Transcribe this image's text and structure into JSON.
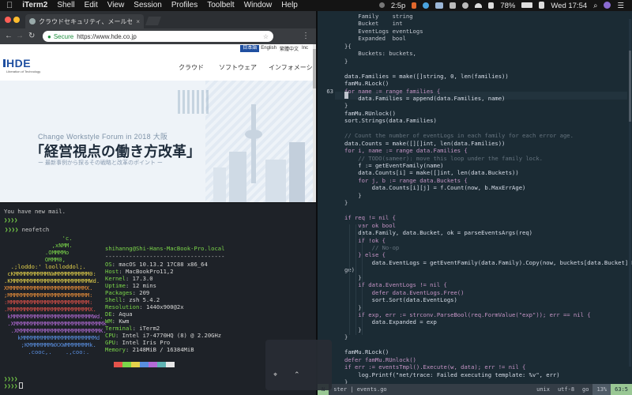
{
  "menubar": {
    "apple": "",
    "app": "iTerm2",
    "items": [
      "Shell",
      "Edit",
      "View",
      "Session",
      "Profiles",
      "Toolbelt",
      "Window",
      "Help"
    ],
    "status_time_left": "2:5p",
    "battery": "78%",
    "clock": "Wed 17:54"
  },
  "chrome": {
    "tab_title": "クラウドセキュリティ、メールセ",
    "tab_close": "×",
    "url_secure": "Secure",
    "url": "https://www.hde.co.jp",
    "star": "☆",
    "menu_dots": "⋮",
    "back": "←",
    "forward": "→",
    "reload": "↻"
  },
  "site": {
    "languages": [
      "日本語",
      "English",
      "繁體中文",
      "Inc"
    ],
    "logo": "HDE",
    "logo_sub": "Liberation of Technology",
    "nav": [
      "クラウド",
      "ソフトウェア",
      "インフォメーシ"
    ],
    "forum": "Change Workstyle Forum in 2018 大阪",
    "headline": "「経営視点の働き方改革」",
    "subline": "ー 最新事例から探るその戦略と改革のポイント ー"
  },
  "terminal": {
    "mail": "You have new mail.",
    "prompt": "❯❯❯❯",
    "command": "neofetch",
    "user_host": "shihanng@Shi-Hans-MacBook-Pro.local",
    "separator": "-----------------------------------",
    "info": [
      {
        "key": "OS",
        "val": "macOS 10.13.2 17C88 x86_64"
      },
      {
        "key": "Host",
        "val": "MacBookPro11,2"
      },
      {
        "key": "Kernel",
        "val": "17.3.0"
      },
      {
        "key": "Uptime",
        "val": "12 mins"
      },
      {
        "key": "Packages",
        "val": "209"
      },
      {
        "key": "Shell",
        "val": "zsh 5.4.2"
      },
      {
        "key": "Resolution",
        "val": "1440x900@2x"
      },
      {
        "key": "DE",
        "val": "Aqua"
      },
      {
        "key": "WM",
        "val": "Kwm"
      },
      {
        "key": "Terminal",
        "val": "iTerm2"
      },
      {
        "key": "CPU",
        "val": "Intel i7-4770HQ (8) @ 2.20GHz"
      },
      {
        "key": "GPU",
        "val": "Intel Iris Pro"
      },
      {
        "key": "Memory",
        "val": "2148MiB / 16384MiB"
      }
    ],
    "ascii": [
      "                 'c.",
      "              ,xNMM.",
      "            .OMMMMo",
      "            OMMM0,",
      "  .;loddo:' loolloddol;.",
      " cKMMMMMMMMMMNWMMMMMMMMMM0:",
      ".KMMMMMMMMMMMMMMMMMMMMMMMWd.",
      "XMMMMMMMMMMMMMMMMMMMMMMMX.",
      ";MMMMMMMMMMMMMMMMMMMMMMMM:",
      ":MMMMMMMMMMMMMMMMMMMMMMMM:",
      ".MMMMMMMMMMMMMMMMMMMMMMMMX.",
      " kMMMMMMMMMMMMMMMMMMMMMMMMWd.",
      " .XMMMMMMMMMMMMMMMMMMMMMMMMMMk",
      "  .XMMMMMMMMMMMMMMMMMMMMMMMMK.",
      "    kMMMMMMMMMMMMMMMMMMMMMMd",
      "     ;KMMMMMMMWXXWMMMMMMMk.",
      "       .cooc,.    .,coo:."
    ],
    "swatch_colors": [
      "#1e2228",
      "#e5534b",
      "#7bd64a",
      "#e5d24b",
      "#5a8fe0",
      "#b36bd6",
      "#5fb3b3",
      "#e6e6e6"
    ]
  },
  "editor": {
    "lines": [
      {
        "n": "",
        "code": "\tFamily    string"
      },
      {
        "n": "",
        "code": "\tBucket    int"
      },
      {
        "n": "",
        "code": "\tEventLogs eventLogs"
      },
      {
        "n": "",
        "code": "\tExpanded  bool"
      },
      {
        "n": "",
        "code": "}{"
      },
      {
        "n": "",
        "code": "\tBuckets: buckets,"
      },
      {
        "n": "",
        "code": "}"
      },
      {
        "n": "",
        "code": ""
      },
      {
        "n": "",
        "code": "data.Families = make([]string, 0, len(families))"
      },
      {
        "n": "",
        "code": "famMu.RLock()"
      },
      {
        "n": "63",
        "code": "for name := range families {"
      },
      {
        "n": "",
        "code": "\tdata.Families = append(data.Families, name)"
      },
      {
        "n": "",
        "code": "}"
      },
      {
        "n": "",
        "code": "famMu.RUnlock()"
      },
      {
        "n": "",
        "code": "sort.Strings(data.Families)"
      },
      {
        "n": "",
        "code": ""
      },
      {
        "n": "",
        "code": "// Count the number of eventLogs in each family for each error age."
      },
      {
        "n": "",
        "code": "data.Counts = make([][]int, len(data.Families))"
      },
      {
        "n": "",
        "code": "for i, name := range data.Families {"
      },
      {
        "n": "",
        "code": "\t// TODO(sameer): move this loop under the family lock."
      },
      {
        "n": "",
        "code": "\tf := getEventFamily(name)"
      },
      {
        "n": "",
        "code": "\tdata.Counts[i] = make([]int, len(data.Buckets))"
      },
      {
        "n": "",
        "code": "\tfor j, b := range data.Buckets {"
      },
      {
        "n": "",
        "code": "\t\tdata.Counts[i][j] = f.Count(now, b.MaxErrAge)"
      },
      {
        "n": "",
        "code": "\t}"
      },
      {
        "n": "",
        "code": "}"
      },
      {
        "n": "",
        "code": ""
      },
      {
        "n": "",
        "code": "if req != nil {"
      },
      {
        "n": "",
        "code": "\tvar ok bool"
      },
      {
        "n": "",
        "code": "\tdata.Family, data.Bucket, ok = parseEventsArgs(req)"
      },
      {
        "n": "",
        "code": "\tif !ok {"
      },
      {
        "n": "",
        "code": "\t\t// No-op"
      },
      {
        "n": "",
        "code": "\t} else {"
      },
      {
        "n": "",
        "code": "\t\tdata.EventLogs = getEventFamily(data.Family).Copy(now, buckets[data.Bucket].MaxErrA"
      },
      {
        "n": "",
        "code": "ge)"
      },
      {
        "n": "",
        "code": "\t}"
      },
      {
        "n": "",
        "code": "\tif data.EventLogs != nil {"
      },
      {
        "n": "",
        "code": "\t\tdefer data.EventLogs.Free()"
      },
      {
        "n": "",
        "code": "\t\tsort.Sort(data.EventLogs)"
      },
      {
        "n": "",
        "code": "\t}"
      },
      {
        "n": "",
        "code": "\tif exp, err := strconv.ParseBool(req.FormValue(\"exp\")); err == nil {"
      },
      {
        "n": "",
        "code": "\t\tdata.Expanded = exp"
      },
      {
        "n": "",
        "code": "\t}"
      },
      {
        "n": "",
        "code": "}"
      },
      {
        "n": "",
        "code": ""
      },
      {
        "n": "",
        "code": "famMu.RLock()"
      },
      {
        "n": "",
        "code": "defer famMu.RUnlock()"
      },
      {
        "n": "",
        "code": "if err := eventsTmpl().Execute(w, data); err != nil {"
      },
      {
        "n": "",
        "code": "\tlog.Printf(\"net/trace: Failed executing template: %v\", err)"
      },
      {
        "n": "",
        "code": "}"
      }
    ],
    "status": {
      "mode": "N",
      "file": "ster | events.go",
      "ft": "unix",
      "enc": "utf-8",
      "lang": "go",
      "pct": "13%",
      "pos": "63:5"
    }
  },
  "overlay": {
    "icon_a": "⌖",
    "icon_b": "⌃"
  }
}
